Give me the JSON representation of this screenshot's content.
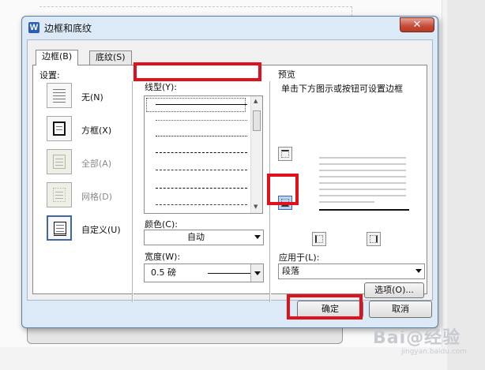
{
  "dialog": {
    "title": "边框和底纹",
    "app_icon_letter": "W",
    "close_glyph": "✕"
  },
  "tabs": [
    {
      "label": "边框(B)",
      "selected": true
    },
    {
      "label": "底纹(S)",
      "selected": false
    }
  ],
  "settings": {
    "heading": "设置:",
    "presets": [
      {
        "label": "无(N)",
        "enabled": true,
        "selected": false,
        "icon": "none-border-icon"
      },
      {
        "label": "方框(X)",
        "enabled": true,
        "selected": false,
        "icon": "box-border-icon"
      },
      {
        "label": "全部(A)",
        "enabled": false,
        "selected": false,
        "icon": "all-border-icon"
      },
      {
        "label": "网格(D)",
        "enabled": false,
        "selected": false,
        "icon": "grid-border-icon"
      },
      {
        "label": "自定义(U)",
        "enabled": true,
        "selected": true,
        "icon": "custom-border-icon"
      }
    ]
  },
  "line_style": {
    "label": "线型(Y):",
    "styles": [
      "solid",
      "dotted-fine",
      "dotted",
      "dashed-small",
      "dashed",
      "dash-dot",
      "dash-dot-dot"
    ],
    "selected_index": 0
  },
  "color": {
    "label": "颜色(C):",
    "value": "自动"
  },
  "width": {
    "label": "宽度(W):",
    "value": "0.5 磅"
  },
  "preview": {
    "heading": "预览",
    "instruction": "单击下方图示或按钮可设置边框"
  },
  "apply_to": {
    "label": "应用于(L):",
    "value": "段落"
  },
  "buttons": {
    "options": "选项(O)...",
    "ok": "确定",
    "cancel": "取消"
  },
  "watermark": {
    "text": "Bai@经验",
    "sub": "jingyan.baidu.com"
  },
  "colors": {
    "highlight": "#e0101c",
    "dialog_frame": "#dce9f6",
    "close_button": "#c24b38",
    "selected_border": "#3f66a8"
  }
}
